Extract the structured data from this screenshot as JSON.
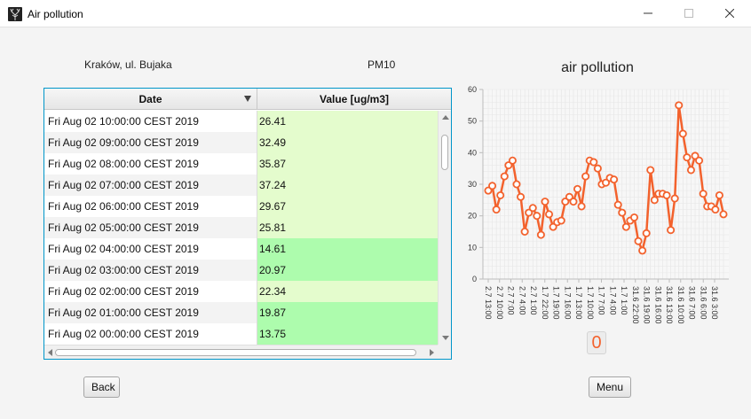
{
  "window": {
    "title": "Air pollution",
    "minimize_glyph": "—",
    "maximize_glyph": "☐",
    "close_glyph": "✕"
  },
  "header": {
    "location": "Kraków, ul. Bujaka",
    "pollutant": "PM10"
  },
  "table": {
    "columns": [
      "Date",
      "Value [ug/m3]"
    ],
    "rows": [
      {
        "date": "Fri Aug 02 10:00:00 CEST 2019",
        "value": "26.41"
      },
      {
        "date": "Fri Aug 02 09:00:00 CEST 2019",
        "value": "32.49"
      },
      {
        "date": "Fri Aug 02 08:00:00 CEST 2019",
        "value": "35.87"
      },
      {
        "date": "Fri Aug 02 07:00:00 CEST 2019",
        "value": "37.24"
      },
      {
        "date": "Fri Aug 02 06:00:00 CEST 2019",
        "value": "29.67"
      },
      {
        "date": "Fri Aug 02 05:00:00 CEST 2019",
        "value": "25.81"
      },
      {
        "date": "Fri Aug 02 04:00:00 CEST 2019",
        "value": "14.61"
      },
      {
        "date": "Fri Aug 02 03:00:00 CEST 2019",
        "value": "20.97"
      },
      {
        "date": "Fri Aug 02 02:00:00 CEST 2019",
        "value": "22.34"
      },
      {
        "date": "Fri Aug 02 01:00:00 CEST 2019",
        "value": "19.87"
      },
      {
        "date": "Fri Aug 02 00:00:00 CEST 2019",
        "value": "13.75"
      }
    ],
    "colors": {
      "low": "#adfcad",
      "medium": "#e4fccd"
    }
  },
  "chart_data": {
    "type": "line",
    "title": "air pollution",
    "xlabel": "",
    "ylabel": "",
    "ylim": [
      0,
      60
    ],
    "y_ticks": [
      "0",
      "10",
      "20",
      "30",
      "40",
      "50",
      "60"
    ],
    "x_tick_labels": [
      "2.7 13:00",
      "2.7 10:00",
      "2.7 7:00",
      "2.7 4:00",
      "2.7 1:00",
      "1.7 22:00",
      "1.7 19:00",
      "1.7 16:00",
      "1.7 13:00",
      "1.7 10:00",
      "1.7 7:00",
      "1.7 4:00",
      "1.7 1:00",
      "31.6 22:00",
      "31.6 19:00",
      "31.6 16:00",
      "31.6 13:00",
      "31.6 10:00",
      "31.6 7:00",
      "31.6 6:00",
      "31.6 3:00"
    ],
    "grid": true,
    "color": "#f3622d",
    "values": [
      28,
      29.5,
      22,
      26.5,
      32.5,
      36,
      37.5,
      30,
      26,
      15,
      21,
      22.5,
      20,
      14,
      24.5,
      20.5,
      16.5,
      18,
      18.5,
      24.5,
      26,
      24.5,
      28.5,
      23,
      32.5,
      37.5,
      37,
      35,
      30,
      30.5,
      32,
      31.5,
      23.5,
      21,
      16.5,
      18.5,
      19.5,
      12,
      9,
      14.5,
      34.5,
      25,
      27,
      27,
      26.5,
      15.5,
      25.5,
      55,
      46,
      38.5,
      34.5,
      39,
      37.5,
      27,
      23,
      23,
      22,
      26.5,
      20.5
    ]
  },
  "counter": {
    "value": "0"
  },
  "buttons": {
    "back": "Back",
    "menu": "Menu"
  }
}
